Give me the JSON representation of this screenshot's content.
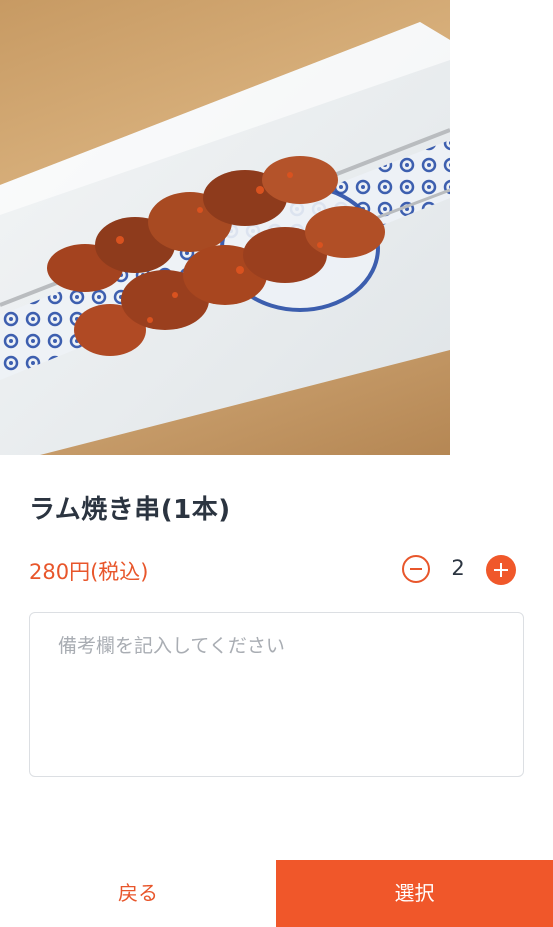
{
  "product": {
    "title": "ラム焼き串(1本)",
    "price": "280円(税込)",
    "quantity": "2",
    "image": "lamb-skewer-photo"
  },
  "note": {
    "placeholder": "備考欄を記入してください",
    "value": ""
  },
  "footer": {
    "back_label": "戻る",
    "select_label": "選択"
  },
  "colors": {
    "accent": "#f0572a",
    "title_text": "#2b3440",
    "placeholder": "#a9adb3"
  },
  "icons": {
    "decrement": "minus-circle-icon",
    "increment": "plus-circle-icon"
  }
}
